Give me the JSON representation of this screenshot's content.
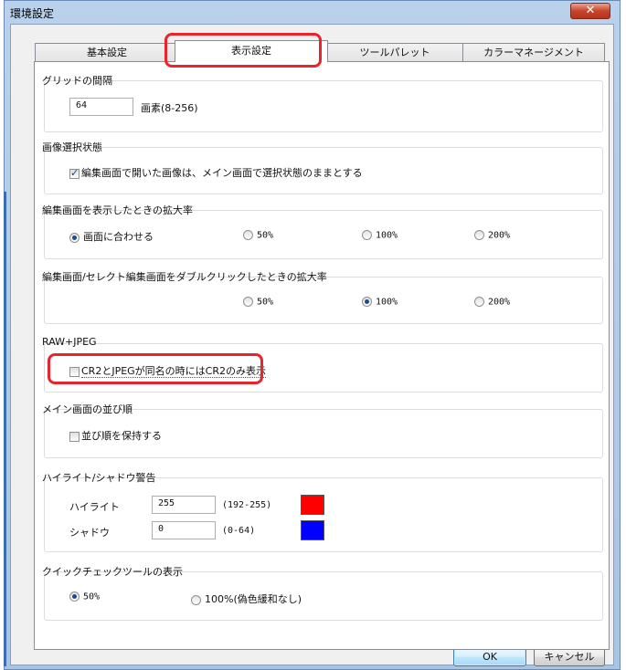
{
  "window": {
    "title": "環境設定",
    "close_glyph": "✕"
  },
  "tabs": [
    {
      "label": "基本設定",
      "active": false
    },
    {
      "label": "表示設定",
      "active": true
    },
    {
      "label": "ツールパレット",
      "active": false
    },
    {
      "label": "カラーマネージメント",
      "active": false
    }
  ],
  "grid": {
    "title": "グリッドの間隔",
    "value": "64",
    "unit": "画素(8-256)"
  },
  "selection": {
    "title": "画像選択状態",
    "checkbox_label": "編集画面で開いた画像は、メイン画面で選択状態のままとする",
    "checked": true
  },
  "edit_zoom": {
    "title": "編集画面を表示したときの拡大率",
    "options": [
      "画面に合わせる",
      "50%",
      "100%",
      "200%"
    ],
    "selected": "画面に合わせる"
  },
  "dblclick_zoom": {
    "title": "編集画面/セレクト編集画面をダブルクリックしたときの拡大率",
    "options": [
      "50%",
      "100%",
      "200%"
    ],
    "selected": "100%"
  },
  "raw_jpeg": {
    "title": "RAW+JPEG",
    "checkbox_label": "CR2とJPEGが同名の時にはCR2のみ表示",
    "checked": false
  },
  "main_order": {
    "title": "メイン画面の並び順",
    "checkbox_label": "並び順を保持する",
    "checked": false
  },
  "warning": {
    "title": "ハイライト/シャドウ警告",
    "highlight_label": "ハイライト",
    "highlight_value": "255",
    "highlight_range": "(192-255)",
    "highlight_color": "#ff0000",
    "shadow_label": "シャドウ",
    "shadow_value": "0",
    "shadow_range": "(0-64)",
    "shadow_color": "#0000ff"
  },
  "quick_check": {
    "title": "クイックチェックツールの表示",
    "options": [
      "50%",
      "100%(偽色緩和なし)"
    ],
    "selected": "50%"
  },
  "buttons": {
    "ok": "OK",
    "cancel": "キャンセル"
  },
  "colors": {
    "annotation_red": "#e8242d",
    "title_bar": "#b9d1ea"
  }
}
